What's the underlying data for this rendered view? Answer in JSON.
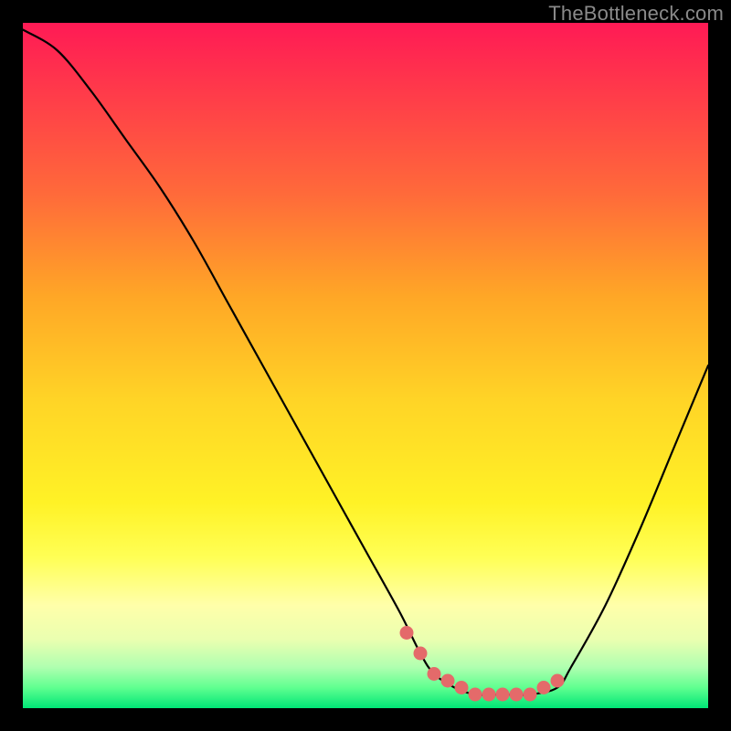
{
  "watermark": {
    "text": "TheBottleneck.com"
  },
  "colors": {
    "curve": "#000000",
    "valley_marker": "#e46a6a",
    "background_black": "#000000"
  },
  "chart_data": {
    "type": "line",
    "title": "",
    "xlabel": "",
    "ylabel": "",
    "xlim": [
      0,
      100
    ],
    "ylim": [
      0,
      100
    ],
    "grid": false,
    "legend": false,
    "series": [
      {
        "name": "bottleneck-curve",
        "x": [
          0,
          5,
          10,
          15,
          20,
          25,
          30,
          35,
          40,
          45,
          50,
          55,
          58,
          60,
          63,
          66,
          70,
          74,
          78,
          80,
          85,
          90,
          95,
          100
        ],
        "y": [
          99,
          96,
          90,
          83,
          76,
          68,
          59,
          50,
          41,
          32,
          23,
          14,
          8,
          5,
          3,
          2,
          2,
          2,
          3,
          6,
          15,
          26,
          38,
          50
        ]
      }
    ],
    "annotations": [
      {
        "name": "optimal-range-markers",
        "style": "dots",
        "points_x": [
          56,
          58,
          60,
          62,
          64,
          66,
          68,
          70,
          72,
          74,
          76,
          78
        ],
        "points_y": [
          11,
          8,
          5,
          4,
          3,
          2,
          2,
          2,
          2,
          2,
          3,
          4
        ]
      }
    ],
    "background_gradient": {
      "type": "vertical",
      "stops": [
        {
          "pos": 0,
          "color": "#ff1a55"
        },
        {
          "pos": 25,
          "color": "#ff6a3a"
        },
        {
          "pos": 55,
          "color": "#ffd426"
        },
        {
          "pos": 78,
          "color": "#ffff55"
        },
        {
          "pos": 90,
          "color": "#eaffb0"
        },
        {
          "pos": 100,
          "color": "#00e676"
        }
      ]
    }
  }
}
